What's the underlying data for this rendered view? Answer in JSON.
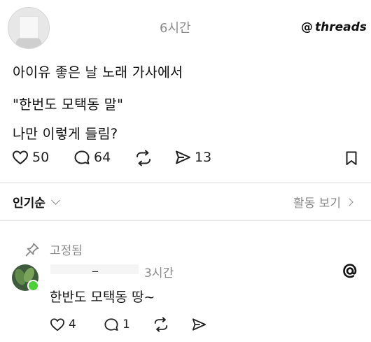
{
  "post": {
    "time": "6시간",
    "brand": "threads",
    "lines": [
      "아이유 좋은 날 노래 가사에서",
      "\"한번도 모택동 말\"",
      "나만 이렇게 들림?"
    ],
    "likes": "50",
    "comments": "64",
    "shares": "13"
  },
  "sort": {
    "label": "인기순",
    "activity_label": "활동 보기"
  },
  "reply": {
    "pinned_label": "고정됨",
    "username": "_",
    "time": "3시간",
    "text": "한반도 모택동 땅~",
    "likes": "4",
    "comments": "1"
  },
  "colors": {
    "online": "#4cd137",
    "muted": "#8a8a8a"
  }
}
